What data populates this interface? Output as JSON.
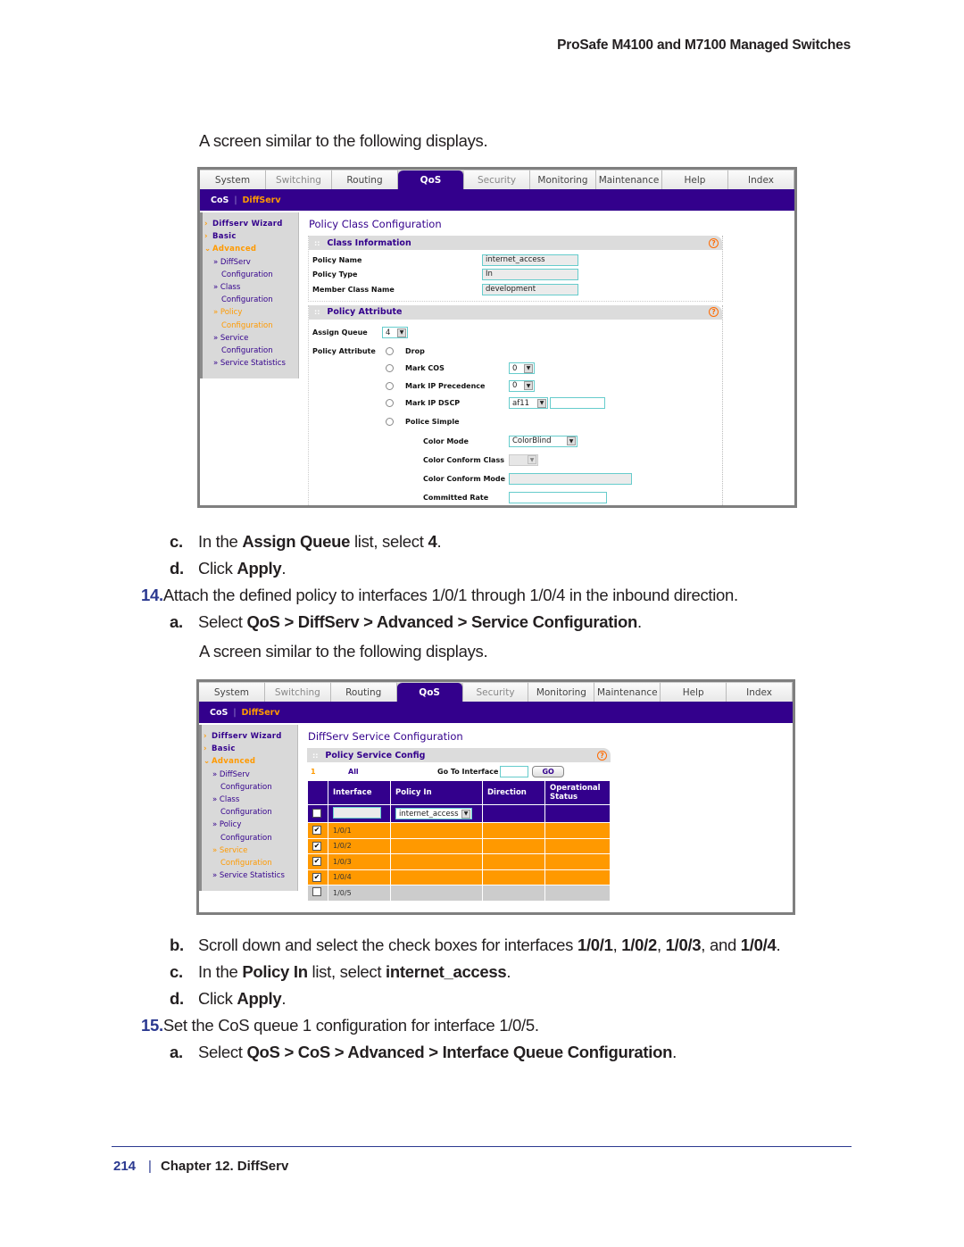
{
  "running_header": "ProSafe M4100 and M7100 Managed Switches",
  "intro_1": "A screen similar to the following displays.",
  "screenshot_1": {
    "tabs": [
      "System",
      "Switching",
      "Routing",
      "QoS",
      "Security",
      "Monitoring",
      "Maintenance",
      "Help",
      "Index"
    ],
    "active_tab": "QoS",
    "subnav": [
      "CoS",
      "DiffServ"
    ],
    "subnav_sep": "|",
    "sidebar": [
      {
        "label": "Diffserv Wizard",
        "level": "top",
        "arrow": ">"
      },
      {
        "label": "Basic",
        "level": "top",
        "arrow": ">"
      },
      {
        "label": "Advanced",
        "level": "top",
        "arrow": "v",
        "active": true
      },
      {
        "label": "» DiffServ",
        "level": "sub"
      },
      {
        "label": "Configuration",
        "level": "sub2"
      },
      {
        "label": "» Class",
        "level": "sub"
      },
      {
        "label": "Configuration",
        "level": "sub2"
      },
      {
        "label": "» Policy",
        "level": "sub",
        "active": true
      },
      {
        "label": "Configuration",
        "level": "sub2",
        "active": true
      },
      {
        "label": "» Service",
        "level": "sub"
      },
      {
        "label": "Configuration",
        "level": "sub2"
      },
      {
        "label": "» Service Statistics",
        "level": "sub"
      }
    ],
    "page_title": "Policy Class Configuration",
    "class_info": {
      "title": "Class Information",
      "policy_name_label": "Policy Name",
      "policy_name_value": "internet_access",
      "policy_type_label": "Policy Type",
      "policy_type_value": "In",
      "member_class_label": "Member Class Name",
      "member_class_value": "development"
    },
    "policy_attr": {
      "title": "Policy Attribute",
      "assign_queue_label": "Assign Queue",
      "assign_queue_value": "4",
      "policy_attribute_label": "Policy Attribute",
      "drop_label": "Drop",
      "mark_cos_label": "Mark COS",
      "mark_cos_value": "0",
      "mark_ip_prec_label": "Mark IP Precedence",
      "mark_ip_prec_value": "0",
      "mark_ip_dscp_label": "Mark IP DSCP",
      "mark_ip_dscp_value": "af11",
      "police_simple_label": "Police Simple",
      "color_mode_label": "Color Mode",
      "color_mode_value": "ColorBlind",
      "color_conform_class_label": "Color Conform Class",
      "color_conform_mode_label": "Color Conform Mode",
      "committed_rate_label": "Committed Rate"
    },
    "help_icon": "?"
  },
  "steps_a": {
    "c_letter": "c.",
    "c_pre": "In the ",
    "c_bold": "Assign Queue",
    "c_mid": " list, select ",
    "c_val": "4",
    "c_end": ".",
    "d_letter": "d.",
    "d_pre": "Click ",
    "d_bold": "Apply",
    "d_end": ".",
    "step14_num": "14.",
    "step14_text": "Attach the defined policy to interfaces 1/0/1 through 1/0/4 in the inbound direction.",
    "a_letter": "a.",
    "a_pre": "Select ",
    "a_path": "QoS > DiffServ > Advanced > Service Configuration",
    "a_end": ".",
    "intro_2": "A screen similar to the following displays."
  },
  "screenshot_2": {
    "tabs": [
      "System",
      "Switching",
      "Routing",
      "QoS",
      "Security",
      "Monitoring",
      "Maintenance",
      "Help",
      "Index"
    ],
    "active_tab": "QoS",
    "subnav": [
      "CoS",
      "DiffServ"
    ],
    "subnav_sep": "|",
    "sidebar": [
      {
        "label": "Diffserv Wizard",
        "level": "top",
        "arrow": ">"
      },
      {
        "label": "Basic",
        "level": "top",
        "arrow": ">"
      },
      {
        "label": "Advanced",
        "level": "top",
        "arrow": "v",
        "active": true
      },
      {
        "label": "» DiffServ",
        "level": "sub"
      },
      {
        "label": "Configuration",
        "level": "sub2"
      },
      {
        "label": "» Class",
        "level": "sub"
      },
      {
        "label": "Configuration",
        "level": "sub2"
      },
      {
        "label": "» Policy",
        "level": "sub"
      },
      {
        "label": "Configuration",
        "level": "sub2"
      },
      {
        "label": "» Service",
        "level": "sub",
        "active": true
      },
      {
        "label": "Configuration",
        "level": "sub2",
        "active": true
      },
      {
        "label": "» Service Statistics",
        "level": "sub"
      }
    ],
    "page_title": "DiffServ Service Configuration",
    "section_title": "Policy Service Config",
    "page_link_1": "1",
    "page_link_all": "All",
    "goto_label": "Go To Interface",
    "go_button": "GO",
    "columns": [
      "",
      "Interface",
      "Policy In",
      "Direction",
      "Operational Status"
    ],
    "filter_policy_in": "internet_access",
    "rows": [
      {
        "interface": "1/0/1",
        "checked": true
      },
      {
        "interface": "1/0/2",
        "checked": true
      },
      {
        "interface": "1/0/3",
        "checked": true
      },
      {
        "interface": "1/0/4",
        "checked": true
      },
      {
        "interface": "1/0/5",
        "checked": false
      }
    ]
  },
  "steps_b": {
    "b_letter": "b.",
    "b_pre": "Scroll down and select the check boxes for interfaces ",
    "b_i1": "1/0/1",
    "b_i2": "1/0/2",
    "b_i3": "1/0/3",
    "b_and": ", and ",
    "b_i4": "1/0/4",
    "b_end": ".",
    "c_letter": "c.",
    "c_pre": "In the ",
    "c_bold": "Policy In",
    "c_mid": " list, select ",
    "c_val": "internet_access",
    "c_end": ".",
    "d_letter": "d.",
    "d_pre": "Click ",
    "d_bold": "Apply",
    "d_end": ".",
    "step15_num": "15.",
    "step15_text": "Set the CoS queue 1 configuration for interface 1/0/5.",
    "a_letter": "a.",
    "a_pre": "Select ",
    "a_path": "QoS > CoS > Advanced > Interface Queue Configuration",
    "a_end": "."
  },
  "footer": {
    "page_number": "214",
    "separator": "|",
    "chapter": "Chapter 12. DiffServ"
  }
}
